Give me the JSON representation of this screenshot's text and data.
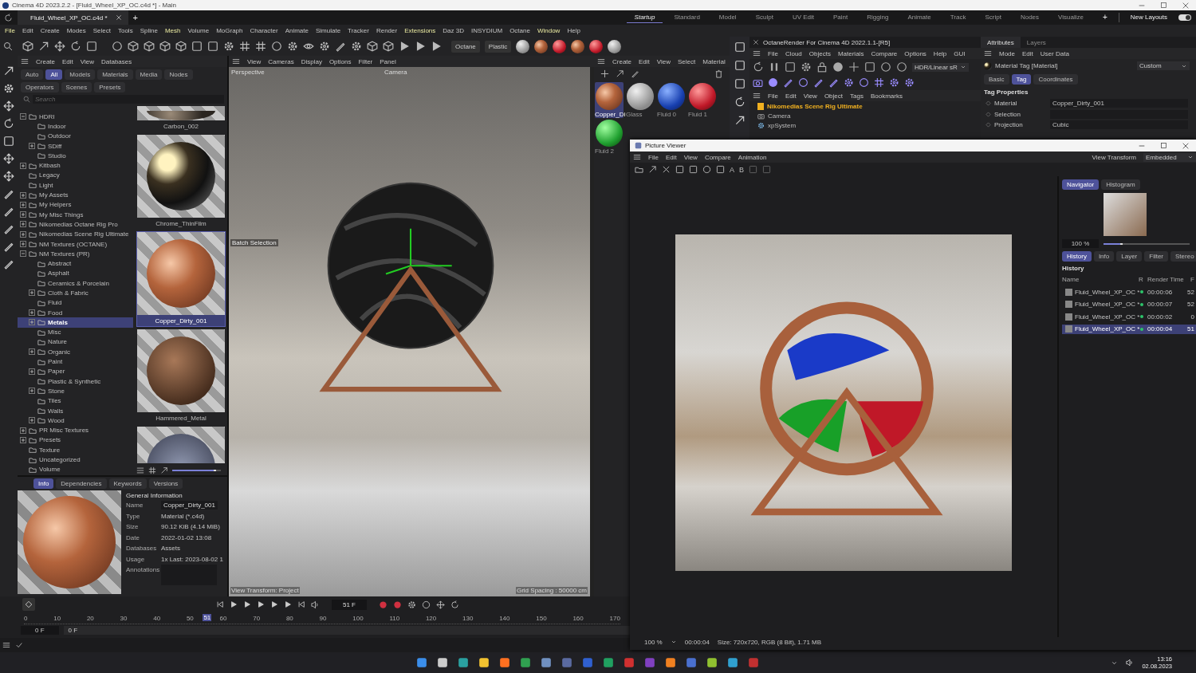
{
  "title_bar": {
    "title": "Cinema 4D 2023.2.2 - [Fluid_Wheel_XP_OC.c4d *] - Main"
  },
  "document_tab": {
    "label": "Fluid_Wheel_XP_OC.c4d *",
    "add": "+"
  },
  "layouts": [
    {
      "label": "Startup",
      "selected": true
    },
    {
      "label": "Standard",
      "selected": false
    },
    {
      "label": "Model",
      "selected": false
    },
    {
      "label": "Sculpt",
      "selected": false
    },
    {
      "label": "UV Edit",
      "selected": false
    },
    {
      "label": "Paint",
      "selected": false
    },
    {
      "label": "Rigging",
      "selected": false
    },
    {
      "label": "Animate",
      "selected": false
    },
    {
      "label": "Track",
      "selected": false
    },
    {
      "label": "Script",
      "selected": false
    },
    {
      "label": "Nodes",
      "selected": false
    },
    {
      "label": "Visualize",
      "selected": false
    }
  ],
  "layout_add": "+",
  "new_layouts": {
    "label": "New Layouts",
    "on": true
  },
  "menu": [
    {
      "label": "File",
      "highlight": true
    },
    {
      "label": "Edit",
      "highlight": false
    },
    {
      "label": "Create",
      "highlight": false
    },
    {
      "label": "Modes",
      "highlight": false
    },
    {
      "label": "Select",
      "highlight": false
    },
    {
      "label": "Tools",
      "highlight": false
    },
    {
      "label": "Spline",
      "highlight": false
    },
    {
      "label": "Mesh",
      "highlight": true
    },
    {
      "label": "Volume",
      "highlight": false
    },
    {
      "label": "MoGraph",
      "highlight": false
    },
    {
      "label": "Character",
      "highlight": false
    },
    {
      "label": "Animate",
      "highlight": false
    },
    {
      "label": "Simulate",
      "highlight": false
    },
    {
      "label": "Tracker",
      "highlight": false
    },
    {
      "label": "Render",
      "highlight": false
    },
    {
      "label": "Extensions",
      "highlight": true
    },
    {
      "label": "Daz 3D",
      "highlight": false
    },
    {
      "label": "INSYDIUM",
      "highlight": false
    },
    {
      "label": "Octane",
      "highlight": false
    },
    {
      "label": "Window",
      "highlight": true
    },
    {
      "label": "Help",
      "highlight": false
    }
  ],
  "toolbar": {
    "buttons": [
      "Octane",
      "Plastic"
    ]
  },
  "asset_browser": {
    "menu": [
      "Create",
      "Edit",
      "View",
      "Databases"
    ],
    "filters": [
      {
        "label": "Auto",
        "selected": false
      },
      {
        "label": "All",
        "selected": true
      },
      {
        "label": "Models",
        "selected": false
      },
      {
        "label": "Materials",
        "selected": false
      },
      {
        "label": "Media",
        "selected": false
      },
      {
        "label": "Nodes",
        "selected": false
      },
      {
        "label": "Operators",
        "selected": false
      },
      {
        "label": "Scenes",
        "selected": false
      },
      {
        "label": "Presets",
        "selected": false
      }
    ],
    "search": {
      "placeholder": "Search"
    },
    "tree": [
      {
        "label": "HDRI",
        "kind": "group",
        "expanded": true,
        "selected": false,
        "children": [
          {
            "label": "Indoor",
            "kind": "leaf",
            "selected": false
          },
          {
            "label": "Outdoor",
            "kind": "leaf",
            "selected": false
          },
          {
            "label": "SDiff",
            "kind": "group",
            "expanded": false,
            "selected": false
          },
          {
            "label": "Studio",
            "kind": "leaf",
            "selected": false
          }
        ]
      },
      {
        "label": "Kitbash",
        "kind": "group",
        "expanded": false,
        "selected": false
      },
      {
        "label": "Legacy",
        "kind": "leaf",
        "selected": false
      },
      {
        "label": "Light",
        "kind": "leaf",
        "selected": false
      },
      {
        "label": "My Assets",
        "kind": "group",
        "expanded": false,
        "selected": false
      },
      {
        "label": "My Helpers",
        "kind": "group",
        "expanded": false,
        "selected": false
      },
      {
        "label": "My Misc Things",
        "kind": "group",
        "expanded": false,
        "selected": false
      },
      {
        "label": "Nikomedias Octane Rig Pro",
        "kind": "group",
        "expanded": false,
        "selected": false
      },
      {
        "label": "Nikomedias Scene Rig Ultimate",
        "kind": "group",
        "expanded": false,
        "selected": false
      },
      {
        "label": "NM Textures (OCTANE)",
        "kind": "group",
        "expanded": false,
        "selected": false
      },
      {
        "label": "NM Textures (PR)",
        "kind": "group",
        "expanded": true,
        "selected": false,
        "children": [
          {
            "label": "Abstract",
            "kind": "leaf",
            "selected": false
          },
          {
            "label": "Asphalt",
            "kind": "leaf",
            "selected": false
          },
          {
            "label": "Ceramics & Porcelain",
            "kind": "leaf",
            "selected": false
          },
          {
            "label": "Cloth & Fabric",
            "kind": "group",
            "expanded": false,
            "selected": false
          },
          {
            "label": "Fluid",
            "kind": "leaf",
            "selected": false
          },
          {
            "label": "Food",
            "kind": "group",
            "expanded": false,
            "selected": false
          },
          {
            "label": "Metals",
            "kind": "group",
            "expanded": false,
            "selected": true
          },
          {
            "label": "Misc",
            "kind": "leaf",
            "selected": false
          },
          {
            "label": "Nature",
            "kind": "leaf",
            "selected": false
          },
          {
            "label": "Organic",
            "kind": "group",
            "expanded": false,
            "selected": false
          },
          {
            "label": "Paint",
            "kind": "leaf",
            "selected": false
          },
          {
            "label": "Paper",
            "kind": "group",
            "expanded": false,
            "selected": false
          },
          {
            "label": "Plastic & Synthetic",
            "kind": "leaf",
            "selected": false
          },
          {
            "label": "Stone",
            "kind": "group",
            "expanded": false,
            "selected": false
          },
          {
            "label": "Tiles",
            "kind": "leaf",
            "selected": false
          },
          {
            "label": "Walls",
            "kind": "leaf",
            "selected": false
          },
          {
            "label": "Wood",
            "kind": "group",
            "expanded": false,
            "selected": false
          }
        ]
      },
      {
        "label": "PR Misc Textures",
        "kind": "group",
        "expanded": false,
        "selected": false
      },
      {
        "label": "Presets",
        "kind": "group",
        "expanded": false,
        "selected": false
      },
      {
        "label": "Texture",
        "kind": "leaf",
        "selected": false
      },
      {
        "label": "Uncategorized",
        "kind": "leaf",
        "selected": false
      },
      {
        "label": "Volume",
        "kind": "leaf",
        "selected": false
      }
    ],
    "thumbnails": [
      {
        "label": "Carbon_002",
        "kind": "carbon",
        "selected": false
      },
      {
        "label": "Chrome_ThinFilm",
        "kind": "chrome",
        "selected": false
      },
      {
        "label": "Copper_Dirty_001",
        "kind": "copper",
        "selected": true
      },
      {
        "label": "Hammered_Metal",
        "kind": "hammered",
        "selected": false
      },
      {
        "kind": "plate",
        "selected": false
      }
    ],
    "thumb_size_slider": {
      "level": 0.9
    }
  },
  "info_panel": {
    "tabs": [
      {
        "label": "Info",
        "selected": true
      },
      {
        "label": "Dependencies",
        "selected": false
      },
      {
        "label": "Keywords",
        "selected": false
      },
      {
        "label": "Versions",
        "selected": false
      }
    ],
    "section": "General Information",
    "fields": [
      {
        "label": "Name",
        "value": "Copper_Dirty_001",
        "kind": "input"
      },
      {
        "label": "Type",
        "value": "Material (*.c4d)",
        "kind": "text"
      },
      {
        "label": "Size",
        "value": "90.12 KiB (4.14 MiB)",
        "kind": "text"
      },
      {
        "label": "Date",
        "value": "2022-01-02 13:08",
        "kind": "text"
      },
      {
        "label": "Databases",
        "value": "Assets",
        "kind": "text"
      },
      {
        "label": "Usage",
        "value": "1x Last: 2023-08-02 1",
        "kind": "text"
      },
      {
        "label": "Annotations",
        "kind": "area"
      }
    ]
  },
  "viewport": {
    "menu": [
      "View",
      "Cameras",
      "Display",
      "Options",
      "Filter",
      "Panel"
    ],
    "view_name": "Perspective",
    "camera": "Camera",
    "selection_tag": "Batch Selection",
    "view_transform": "View Transform: Project",
    "grid_spacing": "Grid Spacing : 50000 cm"
  },
  "material_manager": {
    "menu": [
      "Create",
      "Edit",
      "View",
      "Select",
      "Material"
    ],
    "materials": [
      {
        "label": "Copper_Di",
        "kind": "copper",
        "selected": true
      },
      {
        "label": "Glass",
        "kind": "glass",
        "selected": false
      },
      {
        "label": "Fluid 0",
        "kind": "blue",
        "selected": false
      },
      {
        "label": "Fluid 1",
        "kind": "red",
        "selected": false
      },
      {
        "label": "Fluid 2",
        "kind": "green",
        "selected": false
      }
    ]
  },
  "octane": {
    "title": "OctaneRender For Cinema 4D 2022.1.1-[R5]",
    "menu": [
      "File",
      "Cloud",
      "Objects",
      "Materials",
      "Compare",
      "Options",
      "Help",
      "GUI"
    ],
    "color_mode": "HDR/Linear sR"
  },
  "object_manager": {
    "menu": [
      "File",
      "Edit",
      "View",
      "Object",
      "Tags",
      "Bookmarks"
    ],
    "objects": [
      {
        "label": "Nikomedias Scene Rig Ultimate",
        "kind": "rig"
      },
      {
        "label": "Camera",
        "kind": "camera"
      },
      {
        "label": "xpSystem",
        "kind": "system"
      }
    ]
  },
  "attributes": {
    "tabs": [
      {
        "label": "Attributes",
        "selected": true
      },
      {
        "label": "Layers",
        "selected": false
      }
    ],
    "menu": [
      "Mode",
      "Edit",
      "User Data"
    ],
    "object": "Material Tag [Material]",
    "preset": "Custom",
    "subtabs": [
      {
        "label": "Basic",
        "selected": false
      },
      {
        "label": "Tag",
        "selected": true
      },
      {
        "label": "Coordinates",
        "selected": false
      }
    ],
    "section": "Tag Properties",
    "properties": [
      {
        "label": "Material",
        "value": "Copper_Dirty_001",
        "kind": "link"
      },
      {
        "label": "Selection",
        "kind": "empty"
      },
      {
        "label": "Projection",
        "value": "Cubic",
        "kind": "dropdown"
      }
    ]
  },
  "picture_viewer": {
    "title": "Picture Viewer",
    "menu": [
      "File",
      "Edit",
      "View",
      "Compare",
      "Animation"
    ],
    "view_transform_label": "View Transform",
    "view_transform": "Embedded",
    "compare_buttons": [
      "A",
      "B"
    ],
    "nav_tabs": [
      {
        "label": "Navigator",
        "selected": true
      },
      {
        "label": "Histogram",
        "selected": false
      }
    ],
    "zoom": "100 %",
    "zoom_slider": {
      "level": 0.22
    },
    "tabs": [
      {
        "label": "History",
        "selected": true
      },
      {
        "label": "Info",
        "selected": false
      },
      {
        "label": "Layer",
        "selected": false
      },
      {
        "label": "Filter",
        "selected": false
      },
      {
        "label": "Stereo",
        "selected": false
      }
    ],
    "history_title": "History",
    "columns": [
      "Name",
      "R",
      "Render Time",
      "F"
    ],
    "history": [
      {
        "name": "Fluid_Wheel_XP_OC *",
        "time": "00:00:06",
        "frame": "52",
        "selected": false
      },
      {
        "name": "Fluid_Wheel_XP_OC *",
        "time": "00:00:07",
        "frame": "52",
        "selected": false
      },
      {
        "name": "Fluid_Wheel_XP_OC *",
        "time": "00:00:02",
        "frame": "0",
        "selected": false
      },
      {
        "name": "Fluid_Wheel_XP_OC *",
        "time": "00:00:04",
        "frame": "51",
        "selected": true
      }
    ],
    "status": {
      "zoom": "100 %",
      "time": "00:00:04",
      "size": "Size: 720x720, RGB (8 Bit), 1.71 MB"
    }
  },
  "timeline": {
    "current_frame": "51 F",
    "ruler": [
      "0",
      "10",
      "20",
      "30",
      "40",
      "50",
      "60",
      "70",
      "80",
      "90",
      "100",
      "110",
      "120",
      "130",
      "140",
      "150",
      "160",
      "170"
    ],
    "playhead": {
      "label": "51",
      "level": 0.3
    },
    "start": "0 F",
    "end": "0 F"
  },
  "taskbar": {
    "time": "13:16",
    "date": "02.08.2023"
  }
}
